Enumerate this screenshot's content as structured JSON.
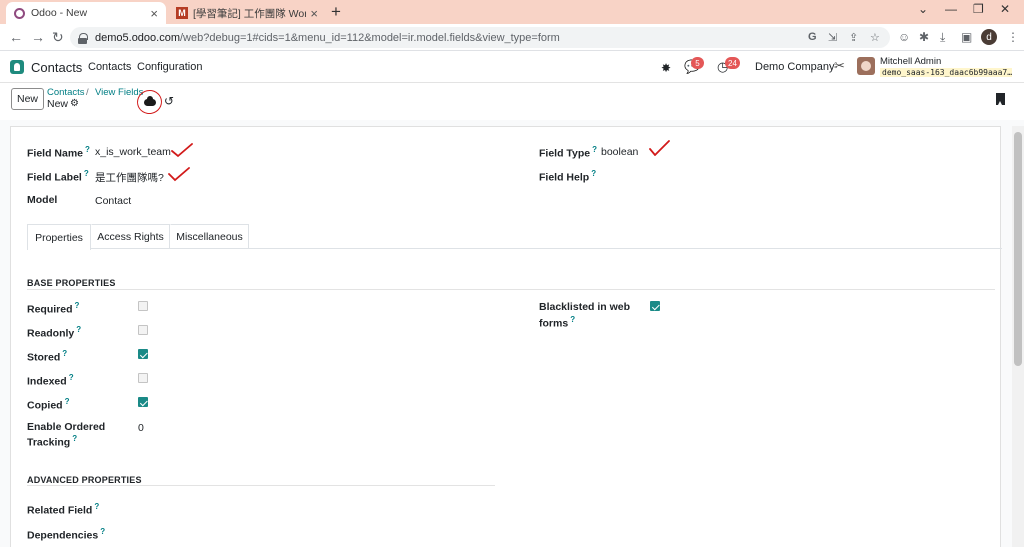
{
  "browser": {
    "tabs": [
      {
        "title": "Odoo - New",
        "favicon": "odoo-icon"
      },
      {
        "title": "[學習筆記] 工作團隊 Work Teams",
        "favicon": "m-icon",
        "favicon_letter": "M"
      }
    ],
    "url_host": "demo5.odoo.com",
    "url_path": "/web?debug=1#cids=1&menu_id=112&model=ir.model.fields&view_type=form",
    "profile_letter": "d"
  },
  "navbar": {
    "app_name": "Contacts",
    "menu": [
      "Contacts",
      "Configuration"
    ],
    "messages_count": "5",
    "activities_count": "24",
    "company": "Demo Company",
    "user_name": "Mitchell Admin",
    "db_name": "demo_saas-163_daac6b99aaa7…"
  },
  "control_panel": {
    "new_label": "New",
    "breadcrumb": [
      "Contacts",
      "View Fields"
    ],
    "current": "New"
  },
  "form": {
    "field_name_label": "Field Name",
    "field_name_value": "x_is_work_team",
    "field_label_label": "Field Label",
    "field_label_value": "是工作團隊嗎?",
    "model_label": "Model",
    "model_value": "Contact",
    "field_type_label": "Field Type",
    "field_type_value": "boolean",
    "field_help_label": "Field Help",
    "tooltip_mark": "?"
  },
  "notebook": {
    "tabs": [
      "Properties",
      "Access Rights",
      "Miscellaneous"
    ],
    "active_tab": "Properties"
  },
  "base_properties": {
    "title": "BASE PROPERTIES",
    "required": {
      "label": "Required",
      "checked": false
    },
    "readonly": {
      "label": "Readonly",
      "checked": false
    },
    "stored": {
      "label": "Stored",
      "checked": true
    },
    "indexed": {
      "label": "Indexed",
      "checked": false
    },
    "copied": {
      "label": "Copied",
      "checked": true
    },
    "ordered_tracking": {
      "label_line1": "Enable Ordered",
      "label_line2": "Tracking",
      "value": "0"
    },
    "blacklisted": {
      "label_line1": "Blacklisted in web",
      "label_line2": "forms",
      "checked": true
    }
  },
  "advanced_properties": {
    "title": "ADVANCED PROPERTIES",
    "related_field_label": "Related Field",
    "dependencies_label": "Dependencies"
  },
  "colors": {
    "accent": "#017e84",
    "checkbox_on": "#1a8a87",
    "annotation_red": "#d21a1a",
    "badge": "#e45757",
    "tab_strip": "#f8d3c6"
  }
}
